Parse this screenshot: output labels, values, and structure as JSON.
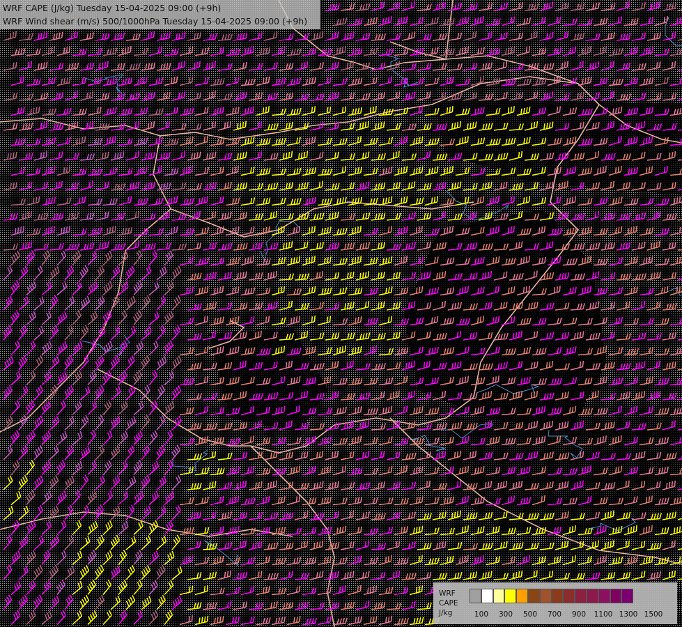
{
  "header": {
    "line1": "WRF CAPE (J/kg) Tuesday 15-04-2025 09:00 (+9h)",
    "line2": "WRF Wind shear (m/s) 500/1000hPa Tuesday 15-04-2025 09:00 (+9h)"
  },
  "legend": {
    "label_lines": [
      "WRF",
      "CAPE",
      "J/kg"
    ],
    "tick_labels": [
      "100",
      "300",
      "500",
      "700",
      "900",
      "1100",
      "1300",
      "1500"
    ],
    "colors": [
      "#a0a0a0",
      "#ffffff",
      "#ffffa0",
      "#ffff00",
      "#ffa000",
      "#8b4513",
      "#a0522d",
      "#8b3a1a",
      "#8b2d2d",
      "#8b2040",
      "#8b1a4a",
      "#8b1060",
      "#800060",
      "#7a0070"
    ]
  },
  "map_style": {
    "barb_colors": [
      "#ff00ff",
      "#e8779a",
      "#e88070",
      "#ffff00",
      "#b06080",
      "#cc55cc"
    ],
    "border_color": "#e8b4a0",
    "river_color": "#4a8ac8"
  }
}
